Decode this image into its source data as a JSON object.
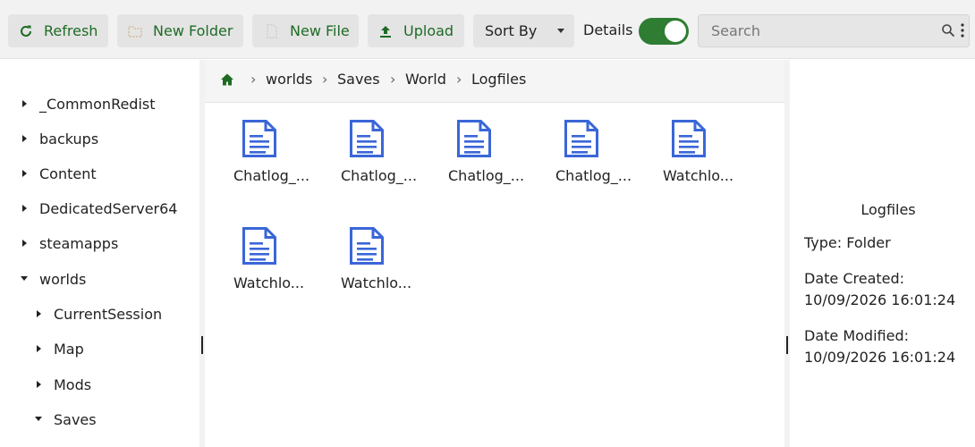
{
  "toolbar": {
    "refresh_label": "Refresh",
    "new_folder_label": "New Folder",
    "new_file_label": "New File",
    "upload_label": "Upload",
    "sort_label": "Sort By",
    "details_label": "Details",
    "details_toggle_on": true,
    "search_placeholder": "Search"
  },
  "sidebar": {
    "items": [
      {
        "label": "_CommonRedist",
        "expanded": false
      },
      {
        "label": "backups",
        "expanded": false
      },
      {
        "label": "Content",
        "expanded": false
      },
      {
        "label": "DedicatedServer64",
        "expanded": false
      },
      {
        "label": "steamapps",
        "expanded": false
      },
      {
        "label": "worlds",
        "expanded": true
      },
      {
        "label": "CurrentSession",
        "expanded": false
      },
      {
        "label": "Map",
        "expanded": false
      },
      {
        "label": "Mods",
        "expanded": false
      },
      {
        "label": "Saves",
        "expanded": true
      }
    ]
  },
  "breadcrumb": {
    "items": [
      "worlds",
      "Saves",
      "World",
      "Logfiles"
    ],
    "separator": "›"
  },
  "files": [
    {
      "name": "Chatlog_..."
    },
    {
      "name": "Chatlog_..."
    },
    {
      "name": "Chatlog_..."
    },
    {
      "name": "Chatlog_..."
    },
    {
      "name": "Watchlo..."
    },
    {
      "name": "Watchlo..."
    },
    {
      "name": "Watchlo..."
    }
  ],
  "details": {
    "title": "Logfiles",
    "type": "Type: Folder",
    "created_label": "Date Created:",
    "created_value": "10/09/2026 16:01:24",
    "modified_label": "Date Modified:",
    "modified_value": "10/09/2026 16:01:24"
  },
  "colors": {
    "accent_green": "#2e7d32",
    "label_green": "#1e6b24",
    "file_icon_blue": "#3a66d8"
  },
  "icons": {
    "refresh": "refresh-icon",
    "new_folder": "new-folder-icon",
    "new_file": "new-file-icon",
    "upload": "upload-icon",
    "search": "search-icon",
    "more": "more-vertical-icon",
    "home": "home-icon",
    "file": "document-icon"
  }
}
